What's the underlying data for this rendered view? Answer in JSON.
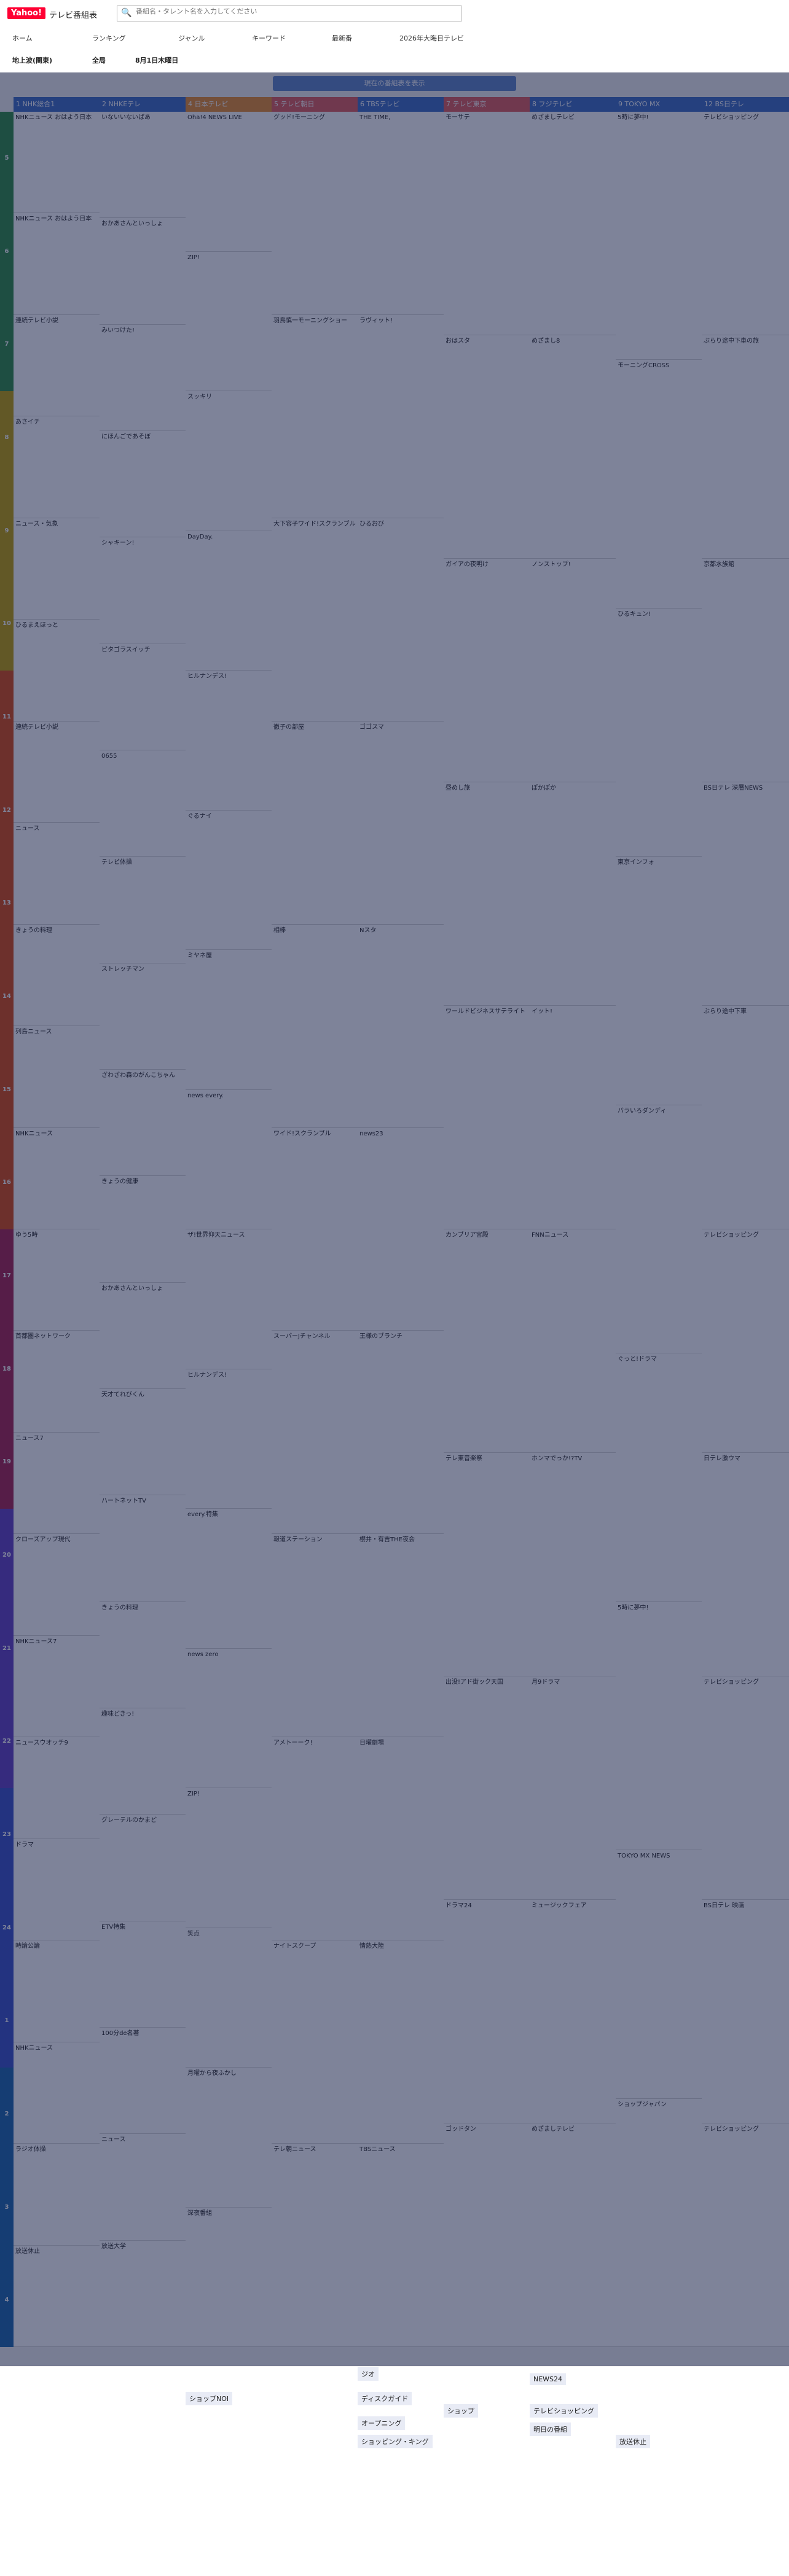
{
  "header": {
    "logo": "Yahoo!",
    "site": "テレビ番組表",
    "search_placeholder": "番組名・タレント名を入力してください"
  },
  "nav": [
    "ホーム",
    "ランキング",
    "ジャンル",
    "キーワード",
    "最新番",
    "2026年大晦日テレビ"
  ],
  "filters": [
    "地上波(関東)",
    "全局",
    "8月1日木曜日"
  ],
  "now_button": "現在の番組表を表示",
  "channels": [
    {
      "name": "1 NHK総合1",
      "color": "#3b6cc4"
    },
    {
      "name": "2 NHKEテレ",
      "color": "#3b6cc4"
    },
    {
      "name": "4 日本テレビ",
      "color": "#e88c2b"
    },
    {
      "name": "5 テレビ朝日",
      "color": "#e05a5a"
    },
    {
      "name": "6 TBSテレビ",
      "color": "#3b6cc4"
    },
    {
      "name": "7 テレビ東京",
      "color": "#e05a5a"
    },
    {
      "name": "8 フジテレビ",
      "color": "#3b6cc4"
    },
    {
      "name": "9 TOKYO MX",
      "color": "#3b6cc4"
    },
    {
      "name": "12 BS日テレ",
      "color": "#3b6cc4"
    }
  ],
  "hours": [
    "5",
    "6",
    "7",
    "8",
    "9",
    "10",
    "11",
    "12",
    "13",
    "14",
    "15",
    "16",
    "17",
    "18",
    "19",
    "20",
    "21",
    "22",
    "23",
    "24",
    "1",
    "2",
    "3",
    "4"
  ],
  "programs": [
    [
      "NHKニュース おはよう日本",
      "NHKニュース おはよう日本",
      "連続テレビ小説",
      "あさイチ",
      "ニュース・気象",
      "ひるまえほっと",
      "連続テレビ小説",
      "ニュース",
      "きょうの料理",
      "列島ニュース",
      "NHKニュース",
      "ゆう5時",
      "首都圏ネットワーク",
      "ニュース7",
      "クローズアップ現代",
      "NHKニュース7",
      "ニュースウオッチ9",
      "ドラマ",
      "時論公論",
      "NHKニュース",
      "ラジオ体操",
      "放送休止"
    ],
    [
      "いないいないばあ",
      "おかあさんといっしょ",
      "みいつけた!",
      "にほんごであそぼ",
      "シャキーン!",
      "ピタゴラスイッチ",
      "0655",
      "テレビ体操",
      "ストレッチマン",
      "ざわざわ森のがんこちゃん",
      "きょうの健康",
      "おかあさんといっしょ",
      "天才てれびくん",
      "ハートネットTV",
      "きょうの料理",
      "趣味どきっ!",
      "グレーテルのかまど",
      "ETV特集",
      "100分de名著",
      "ニュース",
      "放送大学"
    ],
    [
      "Oha!4 NEWS LIVE",
      "ZIP!",
      "スッキリ",
      "DayDay.",
      "ヒルナンデス!",
      "ぐるナイ",
      "ミヤネ屋",
      "news every.",
      "ザ!世界仰天ニュース",
      "ヒルナンデス!",
      "every.特集",
      "news zero",
      "ZIP!",
      "笑点",
      "月曜から夜ふかし",
      "深夜番組"
    ],
    [
      "グッド!モーニング",
      "羽鳥慎一モーニングショー",
      "大下容子ワイド!スクランブル",
      "徹子の部屋",
      "相棒",
      "ワイド!スクランブル",
      "スーパーJチャンネル",
      "報道ステーション",
      "アメトーーク!",
      "ナイトスクープ",
      "テレ朝ニュース"
    ],
    [
      "THE TIME,",
      "ラヴィット!",
      "ひるおび",
      "ゴゴスマ",
      "Nスタ",
      "news23",
      "王様のブランチ",
      "櫻井・有吉THE夜会",
      "日曜劇場",
      "情熱大陸",
      "TBSニュース"
    ],
    [
      "モーサテ",
      "おはスタ",
      "ガイアの夜明け",
      "昼めし旅",
      "ワールドビジネスサテライト",
      "カンブリア宮殿",
      "テレ東音楽祭",
      "出没!アド街ック天国",
      "ドラマ24",
      "ゴッドタン"
    ],
    [
      "めざましテレビ",
      "めざまし8",
      "ノンストップ!",
      "ぽかぽか",
      "イット!",
      "FNNニュース",
      "ホンマでっか!?TV",
      "月9ドラマ",
      "ミュージックフェア",
      "めざましテレビ"
    ],
    [
      "5時に夢中!",
      "モーニングCROSS",
      "ひるキュン!",
      "東京インフォ",
      "バラいろダンディ",
      "ぐっと!ドラマ",
      "5時に夢中!",
      "TOKYO MX NEWS",
      "ショップジャパン"
    ],
    [
      "テレビショッピング",
      "ぶらり途中下車の旅",
      "京都水族館",
      "BS日テレ 深層NEWS",
      "ぶらり途中下車",
      "テレビショッピング",
      "日テレ激ウマ",
      "テレビショッピング",
      "BS日テレ 映画",
      "テレビショッピング"
    ]
  ],
  "lower_items": [
    "ジオ",
    "ディスクガイド",
    "NEWS24",
    "ショップNOI",
    "オープニング",
    "ショッピング・キング",
    "ショップ",
    "テレビショッピング",
    "明日の番組",
    "放送休止"
  ]
}
